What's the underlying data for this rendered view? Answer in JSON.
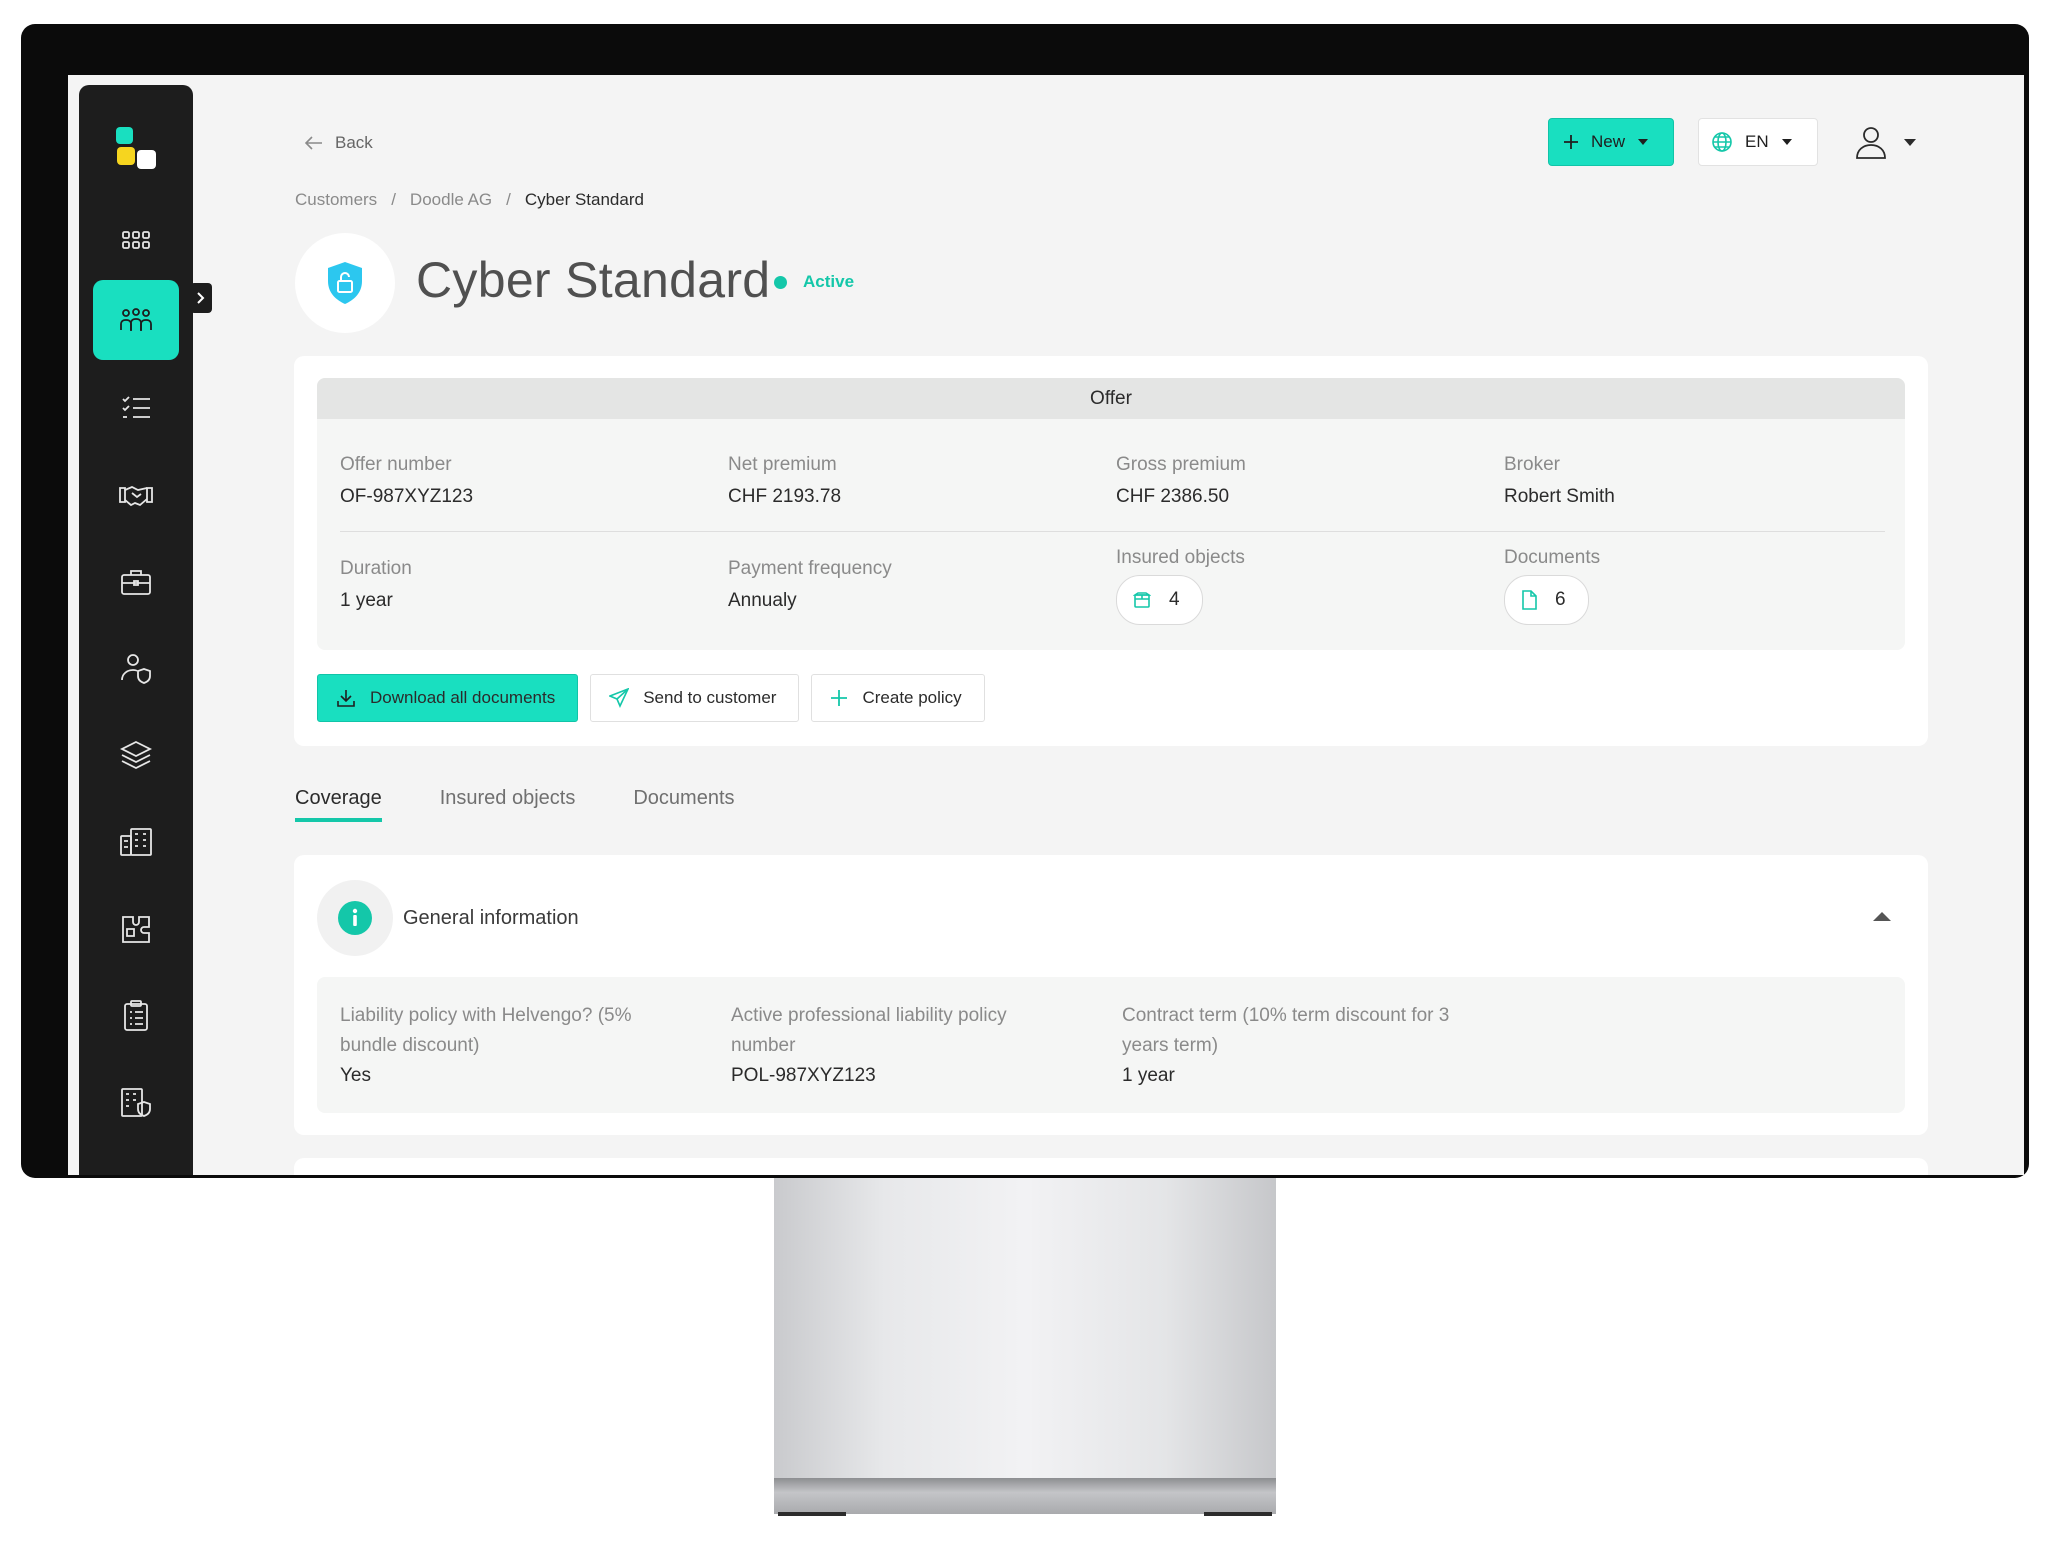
{
  "header": {
    "back_label": "Back",
    "new_label": "New",
    "language": "EN"
  },
  "breadcrumb": [
    "Customers",
    "/",
    "Doodle AG",
    "/",
    "Cyber Standard"
  ],
  "page": {
    "title": "Cyber Standard",
    "status": "Active"
  },
  "offer": {
    "heading": "Offer",
    "fields": [
      {
        "label": "Offer number",
        "value": "OF-987XYZ123"
      },
      {
        "label": "Net premium",
        "value": "CHF 2193.78"
      },
      {
        "label": "Gross premium",
        "value": "CHF 2386.50"
      },
      {
        "label": "Broker",
        "value": "Robert Smith"
      },
      {
        "label": "Duration",
        "value": "1 year"
      },
      {
        "label": "Payment frequency",
        "value": "Annualy"
      },
      {
        "label": "Insured objects",
        "value": "4"
      },
      {
        "label": "Documents",
        "value": "6"
      }
    ],
    "actions": {
      "download": "Download all documents",
      "send": "Send to customer",
      "create": "Create policy"
    }
  },
  "tabs": [
    "Coverage",
    "Insured objects",
    "Documents"
  ],
  "general_info": {
    "title": "General information",
    "fields": [
      {
        "label": "Liability policy with Helvengo? (5% bundle discount)",
        "value": "Yes"
      },
      {
        "label": "Active professional liability policy number",
        "value": "POL-987XYZ123"
      },
      {
        "label": "Contract term (10% term discount for 3 years term)",
        "value": "1 year"
      }
    ]
  },
  "sidebar": {
    "items": [
      "dashboard-icon",
      "customers-icon",
      "tasks-icon",
      "partners-icon",
      "portfolio-icon",
      "user-shield-icon",
      "layers-icon",
      "buildings-icon",
      "puzzle-icon",
      "clipboard-icon",
      "building-shield-icon"
    ]
  },
  "colors": {
    "accent": "#19dfc0",
    "sidebar": "#1d1d1d",
    "background": "#f4f4f4"
  }
}
